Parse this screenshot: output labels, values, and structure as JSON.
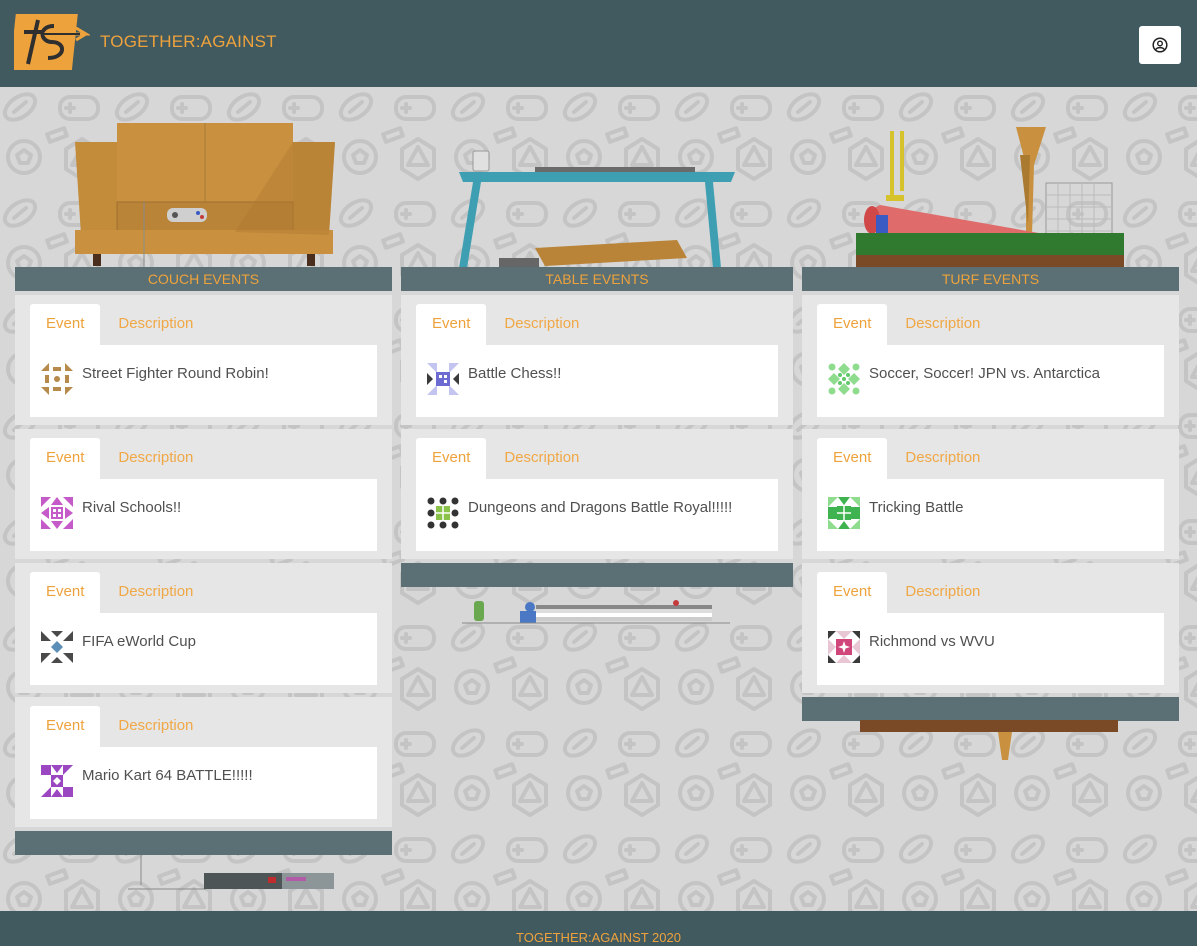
{
  "header": {
    "brand_title": "TOGETHER:AGAINST",
    "logo_icon": "ts-logo-icon",
    "user_icon": "user-circle-icon"
  },
  "tabs": {
    "event_label": "Event",
    "description_label": "Description"
  },
  "columns": [
    {
      "title": "COUCH EVENTS",
      "events": [
        {
          "title": "Street Fighter Round Robin!",
          "avatar_color": "#b58a4a"
        },
        {
          "title": "Rival Schools!!",
          "avatar_color": "#c45bc8"
        },
        {
          "title": "FIFA eWorld Cup",
          "avatar_color": "#5b8fb8"
        },
        {
          "title": "Mario Kart 64 BATTLE!!!!!",
          "avatar_color": "#9b47c2"
        }
      ]
    },
    {
      "title": "TABLE EVENTS",
      "events": [
        {
          "title": "Battle Chess!!",
          "avatar_color": "#6b6bd1"
        },
        {
          "title": "Dungeons and Dragons Battle Royal!!!!!",
          "avatar_color": "#8bc34a"
        }
      ]
    },
    {
      "title": "TURF EVENTS",
      "events": [
        {
          "title": "Soccer, Soccer! JPN vs. Antarctica",
          "avatar_color": "#5fc96a"
        },
        {
          "title": "Tricking Battle",
          "avatar_color": "#3fb34f"
        },
        {
          "title": "Richmond vs WVU",
          "avatar_color": "#d0457a"
        }
      ]
    }
  ],
  "footer": {
    "text": "TOGETHER:AGAINST 2020"
  },
  "colors": {
    "header_bg": "#415a60",
    "accent": "#eea23c",
    "column_bar": "#5a7074",
    "page_bg": "#d7d7d7"
  }
}
